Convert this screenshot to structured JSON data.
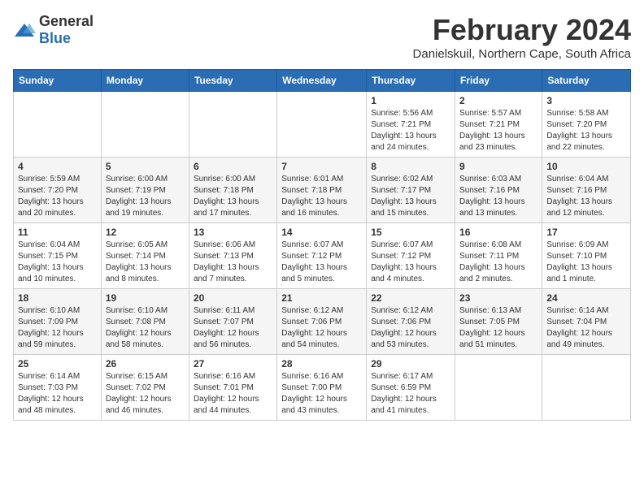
{
  "logo": {
    "general": "General",
    "blue": "Blue"
  },
  "title": "February 2024",
  "subtitle": "Danielskuil, Northern Cape, South Africa",
  "days_header": [
    "Sunday",
    "Monday",
    "Tuesday",
    "Wednesday",
    "Thursday",
    "Friday",
    "Saturday"
  ],
  "weeks": [
    [
      {
        "day": "",
        "info": ""
      },
      {
        "day": "",
        "info": ""
      },
      {
        "day": "",
        "info": ""
      },
      {
        "day": "",
        "info": ""
      },
      {
        "day": "1",
        "info": "Sunrise: 5:56 AM\nSunset: 7:21 PM\nDaylight: 13 hours\nand 24 minutes."
      },
      {
        "day": "2",
        "info": "Sunrise: 5:57 AM\nSunset: 7:21 PM\nDaylight: 13 hours\nand 23 minutes."
      },
      {
        "day": "3",
        "info": "Sunrise: 5:58 AM\nSunset: 7:20 PM\nDaylight: 13 hours\nand 22 minutes."
      }
    ],
    [
      {
        "day": "4",
        "info": "Sunrise: 5:59 AM\nSunset: 7:20 PM\nDaylight: 13 hours\nand 20 minutes."
      },
      {
        "day": "5",
        "info": "Sunrise: 6:00 AM\nSunset: 7:19 PM\nDaylight: 13 hours\nand 19 minutes."
      },
      {
        "day": "6",
        "info": "Sunrise: 6:00 AM\nSunset: 7:18 PM\nDaylight: 13 hours\nand 17 minutes."
      },
      {
        "day": "7",
        "info": "Sunrise: 6:01 AM\nSunset: 7:18 PM\nDaylight: 13 hours\nand 16 minutes."
      },
      {
        "day": "8",
        "info": "Sunrise: 6:02 AM\nSunset: 7:17 PM\nDaylight: 13 hours\nand 15 minutes."
      },
      {
        "day": "9",
        "info": "Sunrise: 6:03 AM\nSunset: 7:16 PM\nDaylight: 13 hours\nand 13 minutes."
      },
      {
        "day": "10",
        "info": "Sunrise: 6:04 AM\nSunset: 7:16 PM\nDaylight: 13 hours\nand 12 minutes."
      }
    ],
    [
      {
        "day": "11",
        "info": "Sunrise: 6:04 AM\nSunset: 7:15 PM\nDaylight: 13 hours\nand 10 minutes."
      },
      {
        "day": "12",
        "info": "Sunrise: 6:05 AM\nSunset: 7:14 PM\nDaylight: 13 hours\nand 8 minutes."
      },
      {
        "day": "13",
        "info": "Sunrise: 6:06 AM\nSunset: 7:13 PM\nDaylight: 13 hours\nand 7 minutes."
      },
      {
        "day": "14",
        "info": "Sunrise: 6:07 AM\nSunset: 7:12 PM\nDaylight: 13 hours\nand 5 minutes."
      },
      {
        "day": "15",
        "info": "Sunrise: 6:07 AM\nSunset: 7:12 PM\nDaylight: 13 hours\nand 4 minutes."
      },
      {
        "day": "16",
        "info": "Sunrise: 6:08 AM\nSunset: 7:11 PM\nDaylight: 13 hours\nand 2 minutes."
      },
      {
        "day": "17",
        "info": "Sunrise: 6:09 AM\nSunset: 7:10 PM\nDaylight: 13 hours\nand 1 minute."
      }
    ],
    [
      {
        "day": "18",
        "info": "Sunrise: 6:10 AM\nSunset: 7:09 PM\nDaylight: 12 hours\nand 59 minutes."
      },
      {
        "day": "19",
        "info": "Sunrise: 6:10 AM\nSunset: 7:08 PM\nDaylight: 12 hours\nand 58 minutes."
      },
      {
        "day": "20",
        "info": "Sunrise: 6:11 AM\nSunset: 7:07 PM\nDaylight: 12 hours\nand 56 minutes."
      },
      {
        "day": "21",
        "info": "Sunrise: 6:12 AM\nSunset: 7:06 PM\nDaylight: 12 hours\nand 54 minutes."
      },
      {
        "day": "22",
        "info": "Sunrise: 6:12 AM\nSunset: 7:06 PM\nDaylight: 12 hours\nand 53 minutes."
      },
      {
        "day": "23",
        "info": "Sunrise: 6:13 AM\nSunset: 7:05 PM\nDaylight: 12 hours\nand 51 minutes."
      },
      {
        "day": "24",
        "info": "Sunrise: 6:14 AM\nSunset: 7:04 PM\nDaylight: 12 hours\nand 49 minutes."
      }
    ],
    [
      {
        "day": "25",
        "info": "Sunrise: 6:14 AM\nSunset: 7:03 PM\nDaylight: 12 hours\nand 48 minutes."
      },
      {
        "day": "26",
        "info": "Sunrise: 6:15 AM\nSunset: 7:02 PM\nDaylight: 12 hours\nand 46 minutes."
      },
      {
        "day": "27",
        "info": "Sunrise: 6:16 AM\nSunset: 7:01 PM\nDaylight: 12 hours\nand 44 minutes."
      },
      {
        "day": "28",
        "info": "Sunrise: 6:16 AM\nSunset: 7:00 PM\nDaylight: 12 hours\nand 43 minutes."
      },
      {
        "day": "29",
        "info": "Sunrise: 6:17 AM\nSunset: 6:59 PM\nDaylight: 12 hours\nand 41 minutes."
      },
      {
        "day": "",
        "info": ""
      },
      {
        "day": "",
        "info": ""
      }
    ]
  ]
}
